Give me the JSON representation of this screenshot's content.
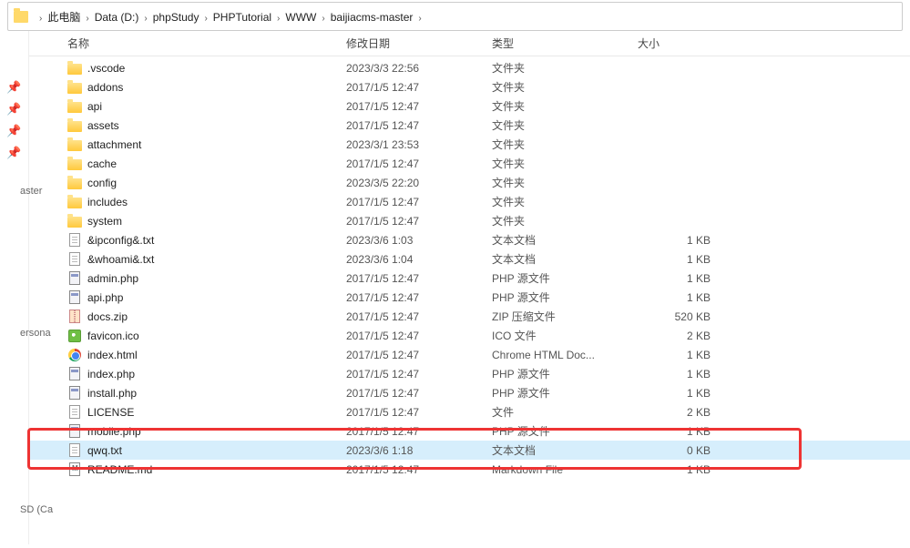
{
  "breadcrumbs": [
    {
      "label": "此电脑"
    },
    {
      "label": "Data (D:)"
    },
    {
      "label": "phpStudy"
    },
    {
      "label": "PHPTutorial"
    },
    {
      "label": "WWW"
    },
    {
      "label": "baijiacms-master"
    }
  ],
  "columns": {
    "name": "名称",
    "date": "修改日期",
    "type": "类型",
    "size": "大小"
  },
  "side_labels": {
    "a": "aster",
    "b": "ersona",
    "c": "SD (Ca"
  },
  "files": [
    {
      "icon": "folder",
      "name": ".vscode",
      "date": "2023/3/3 22:56",
      "type": "文件夹",
      "size": ""
    },
    {
      "icon": "folder",
      "name": "addons",
      "date": "2017/1/5 12:47",
      "type": "文件夹",
      "size": ""
    },
    {
      "icon": "folder",
      "name": "api",
      "date": "2017/1/5 12:47",
      "type": "文件夹",
      "size": ""
    },
    {
      "icon": "folder",
      "name": "assets",
      "date": "2017/1/5 12:47",
      "type": "文件夹",
      "size": ""
    },
    {
      "icon": "folder",
      "name": "attachment",
      "date": "2023/3/1 23:53",
      "type": "文件夹",
      "size": ""
    },
    {
      "icon": "folder",
      "name": "cache",
      "date": "2017/1/5 12:47",
      "type": "文件夹",
      "size": ""
    },
    {
      "icon": "folder",
      "name": "config",
      "date": "2023/3/5 22:20",
      "type": "文件夹",
      "size": ""
    },
    {
      "icon": "folder",
      "name": "includes",
      "date": "2017/1/5 12:47",
      "type": "文件夹",
      "size": ""
    },
    {
      "icon": "folder",
      "name": "system",
      "date": "2017/1/5 12:47",
      "type": "文件夹",
      "size": ""
    },
    {
      "icon": "text",
      "name": "&ipconfig&.txt",
      "date": "2023/3/6 1:03",
      "type": "文本文档",
      "size": "1 KB"
    },
    {
      "icon": "text",
      "name": "&whoami&.txt",
      "date": "2023/3/6 1:04",
      "type": "文本文档",
      "size": "1 KB"
    },
    {
      "icon": "php",
      "name": "admin.php",
      "date": "2017/1/5 12:47",
      "type": "PHP 源文件",
      "size": "1 KB"
    },
    {
      "icon": "php",
      "name": "api.php",
      "date": "2017/1/5 12:47",
      "type": "PHP 源文件",
      "size": "1 KB"
    },
    {
      "icon": "zip",
      "name": "docs.zip",
      "date": "2017/1/5 12:47",
      "type": "ZIP 压缩文件",
      "size": "520 KB"
    },
    {
      "icon": "ico",
      "name": "favicon.ico",
      "date": "2017/1/5 12:47",
      "type": "ICO 文件",
      "size": "2 KB"
    },
    {
      "icon": "chrome",
      "name": "index.html",
      "date": "2017/1/5 12:47",
      "type": "Chrome HTML Doc...",
      "size": "1 KB"
    },
    {
      "icon": "php",
      "name": "index.php",
      "date": "2017/1/5 12:47",
      "type": "PHP 源文件",
      "size": "1 KB"
    },
    {
      "icon": "php",
      "name": "install.php",
      "date": "2017/1/5 12:47",
      "type": "PHP 源文件",
      "size": "1 KB"
    },
    {
      "icon": "text",
      "name": "LICENSE",
      "date": "2017/1/5 12:47",
      "type": "文件",
      "size": "2 KB"
    },
    {
      "icon": "php",
      "name": "mobile.php",
      "date": "2017/1/5 12:47",
      "type": "PHP 源文件",
      "size": "1 KB"
    },
    {
      "icon": "text",
      "name": "qwq.txt",
      "date": "2023/3/6 1:18",
      "type": "文本文档",
      "size": "0 KB",
      "selected": true
    },
    {
      "icon": "md",
      "name": "README.md",
      "date": "2017/1/5 12:47",
      "type": "Markdown File",
      "size": "1 KB"
    }
  ],
  "highlighted_row_name": "qwq.txt"
}
